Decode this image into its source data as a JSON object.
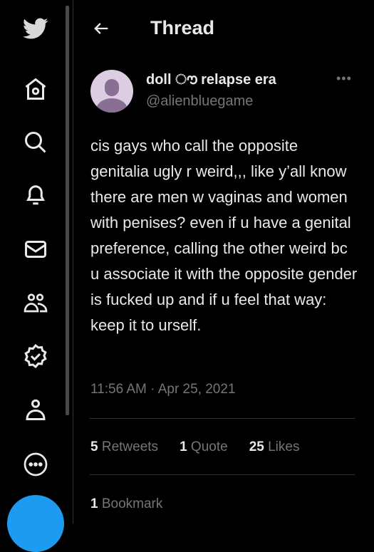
{
  "header": {
    "title": "Thread"
  },
  "sidebar": {
    "items": [
      "twitter-logo",
      "home",
      "explore",
      "notifications",
      "messages",
      "communities",
      "verified",
      "profile",
      "more"
    ]
  },
  "tweet": {
    "author_name": "doll ൗ relapse era",
    "handle": "@alienbluegame",
    "text": "cis gays who call the opposite genitalia ugly r weird,,, like y’all know there are men w vaginas and women with penises? even if u have a genital preference, calling the other weird bc u associate it with the opposite gender is fucked up and if u feel that way: keep it to urself.",
    "timestamp": "11:56 AM · Apr 25, 2021",
    "stats": {
      "retweets_count": "5",
      "retweets_label": "Retweets",
      "quotes_count": "1",
      "quotes_label": "Quote",
      "likes_count": "25",
      "likes_label": "Likes",
      "bookmarks_count": "1",
      "bookmarks_label": "Bookmark"
    }
  },
  "colors": {
    "accent": "#1d9bf0",
    "avatar_bg": "#dccde2",
    "avatar_fg": "#8a6f95"
  }
}
